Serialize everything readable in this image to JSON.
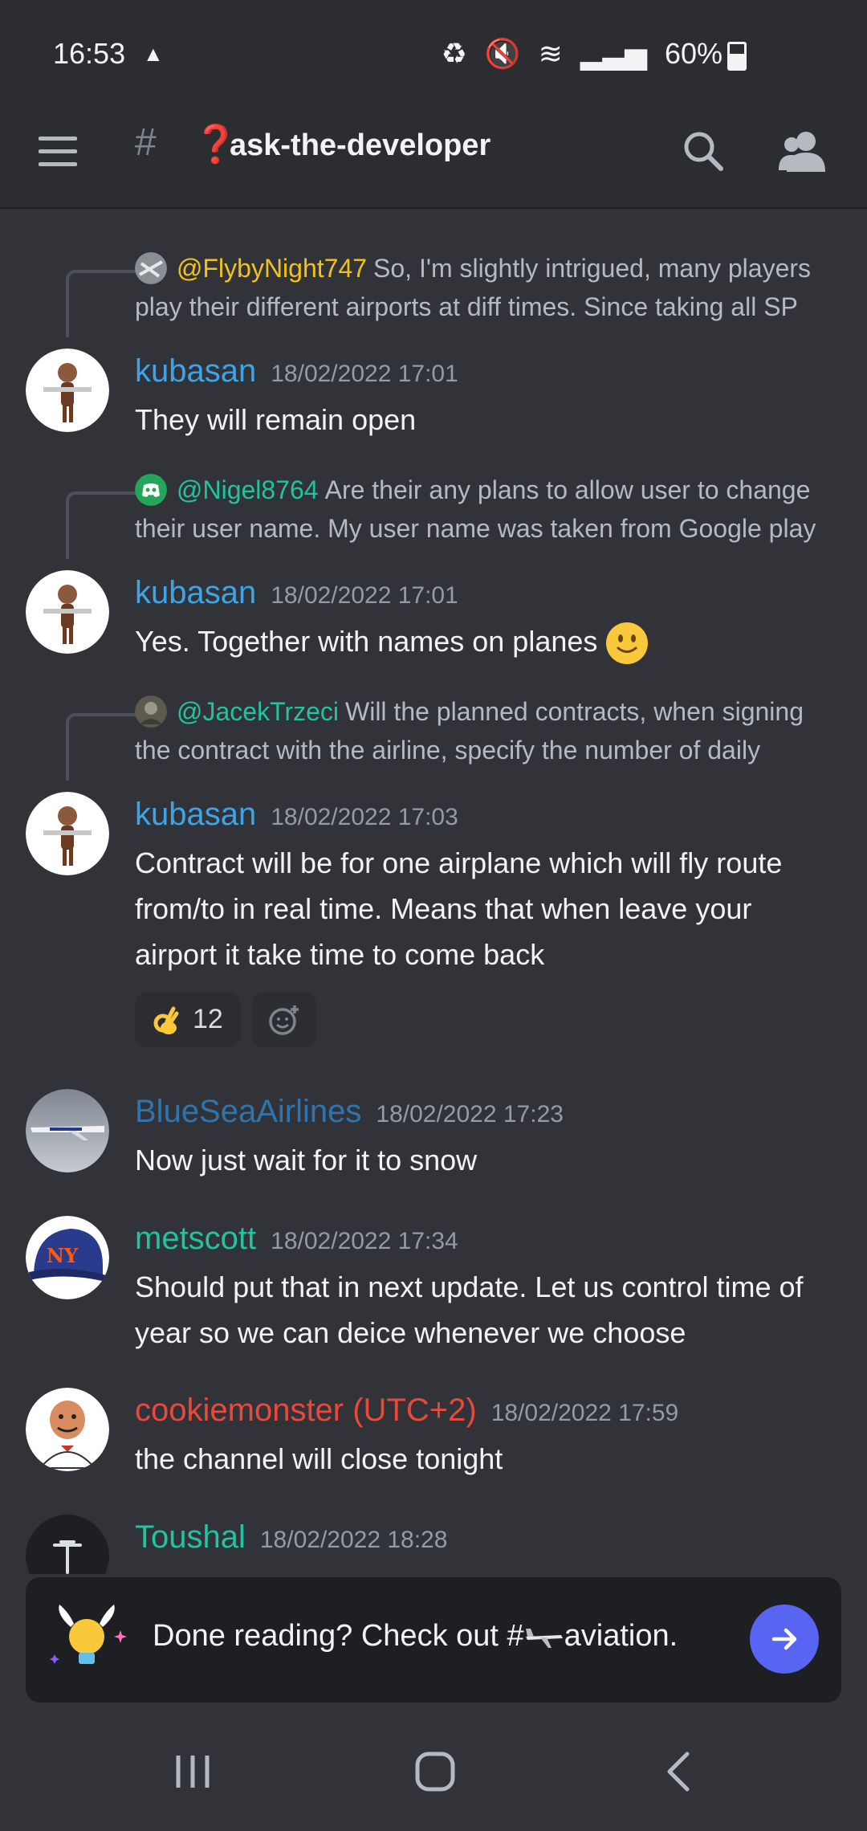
{
  "status": {
    "time": "16:53",
    "battery": "60%"
  },
  "channel": {
    "name": "ask-the-developer",
    "emoji": "❓"
  },
  "messages": [
    {
      "reply": {
        "author": "@FlybyNight747",
        "author_color": "#f0c31a",
        "text": "So, I'm slightly intrigued, many players play their different airports at diff times.  Since taking all SP"
      },
      "author": "kubasan",
      "author_color": "#3ea4e6",
      "time": "18/02/2022 17:01",
      "text": "They will remain open"
    },
    {
      "reply": {
        "author": "@Nigel8764",
        "author_color": "#23c2a0",
        "text": "Are their any plans to allow user to change their user name.  My user name was taken from Google play"
      },
      "author": "kubasan",
      "author_color": "#3ea4e6",
      "time": "18/02/2022 17:01",
      "text": "Yes. Together with names on planes"
    },
    {
      "reply": {
        "author": "@JacekTrzeci",
        "author_color": "#23c2a0",
        "text": "Will the planned contracts, when signing the contract with the airline, specify the number of daily"
      },
      "author": "kubasan",
      "author_color": "#3ea4e6",
      "time": "18/02/2022 17:03",
      "text": "Contract will be for one airplane which will fly route from/to in real time. Means that when leave your airport it take time to come back",
      "reaction_count": "12"
    },
    {
      "author": "BlueSeaAirlines",
      "author_color": "#2f74ad",
      "time": "18/02/2022 17:23",
      "text": "Now just wait for it to snow"
    },
    {
      "author": "metscott",
      "author_color": "#23c2a0",
      "time": "18/02/2022 17:34",
      "text": "Should put that in next update. Let us control time of year so we can deice whenever we choose"
    },
    {
      "author": "cookiemonster (UTC+2)",
      "author_color": "#e8493a",
      "time": "18/02/2022 17:59",
      "text": "the channel will close tonight"
    },
    {
      "author": "Toushal",
      "author_color": "#23c2a0",
      "time": "18/02/2022 18:28",
      "text": ""
    }
  ],
  "banner": {
    "text_prefix": "Done reading? Check out #",
    "text_suffix": "aviation."
  }
}
